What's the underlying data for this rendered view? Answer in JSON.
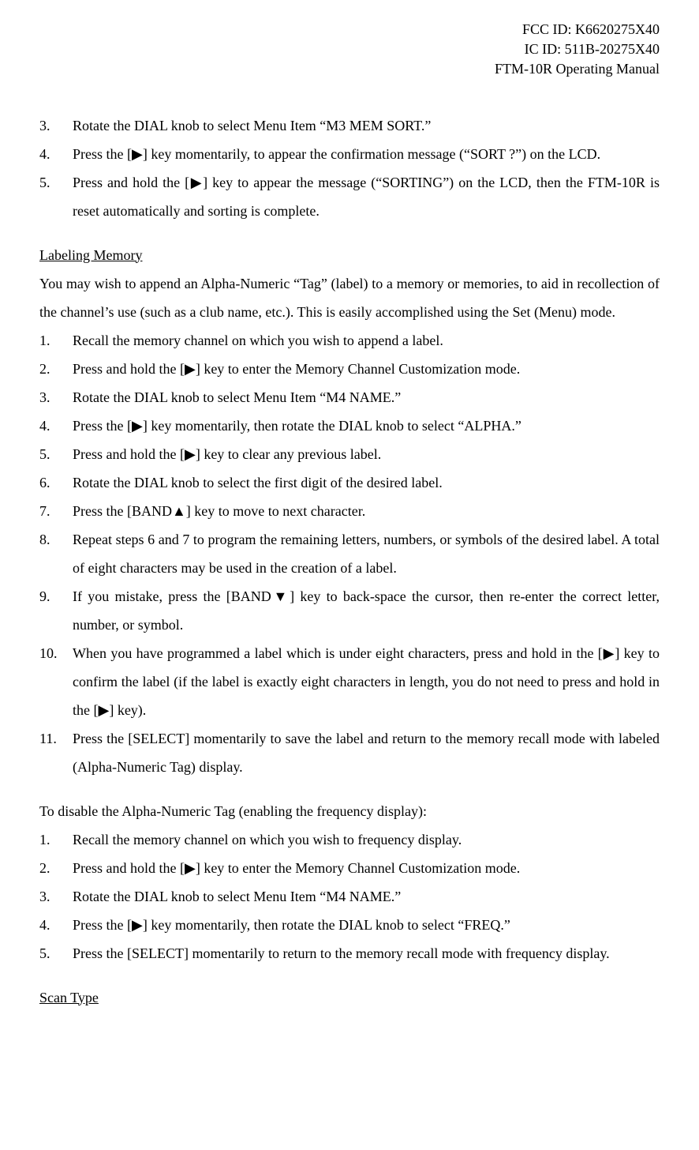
{
  "header": {
    "fcc": "FCC ID: K6620275X40",
    "ic": "IC ID: 511B-20275X40",
    "title": "FTM-10R Operating Manual"
  },
  "section1": {
    "items": [
      "Rotate the DIAL knob to select Menu Item “M3 MEM SORT.”",
      "Press the [▶] key momentarily, to appear the confirmation message (“SORT ?”) on the LCD.",
      "Press and hold the [▶] key to appear the message (“SORTING”) on the LCD, then the FTM-10R is reset automatically and sorting is complete."
    ]
  },
  "labeling": {
    "title": "Labeling Memory",
    "intro": "You may wish to append an Alpha-Numeric “Tag” (label) to a memory or memories, to aid in recollection of the channel’s use (such as a club name, etc.). This is easily accomplished using the Set (Menu) mode.",
    "items": [
      "Recall the memory channel on which you wish to append a label.",
      "Press and hold the [▶] key to enter the Memory Channel Customization mode.",
      "Rotate the DIAL knob to select Menu Item “M4 NAME.”",
      "Press the [▶] key momentarily, then rotate the DIAL knob to select “ALPHA.”",
      "Press and hold the [▶] key to clear any previous label.",
      "Rotate the DIAL knob to select the first digit of the desired label.",
      "Press the [BAND▲] key to move to next character.",
      "Repeat steps 6 and 7 to program the remaining letters, numbers, or symbols of the desired label. A total of eight characters may be used in the creation of a label.",
      "If you mistake, press the [BAND▼] key to back-space the cursor, then re-enter the correct letter, number, or symbol.",
      "When you have programmed a label which is under eight characters, press and hold in the [▶] key to confirm the label (if the label is exactly eight characters in length, you do not need to press and hold in the [▶] key).",
      "Press the [SELECT] momentarily to save the label and return to the memory recall mode with labeled (Alpha-Numeric Tag) display."
    ]
  },
  "disable": {
    "intro": "To disable the Alpha-Numeric Tag (enabling the frequency display):",
    "items": [
      "Recall the memory channel on which you wish to frequency display.",
      "Press and hold the [▶] key to enter the Memory Channel Customization mode.",
      "Rotate the DIAL knob to select Menu Item “M4 NAME.”",
      "Press the [▶] key momentarily, then rotate the DIAL knob to select “FREQ.”",
      "Press the [SELECT] momentarily to return to the memory recall mode with frequency display."
    ]
  },
  "scan": {
    "title": "Scan Type"
  }
}
